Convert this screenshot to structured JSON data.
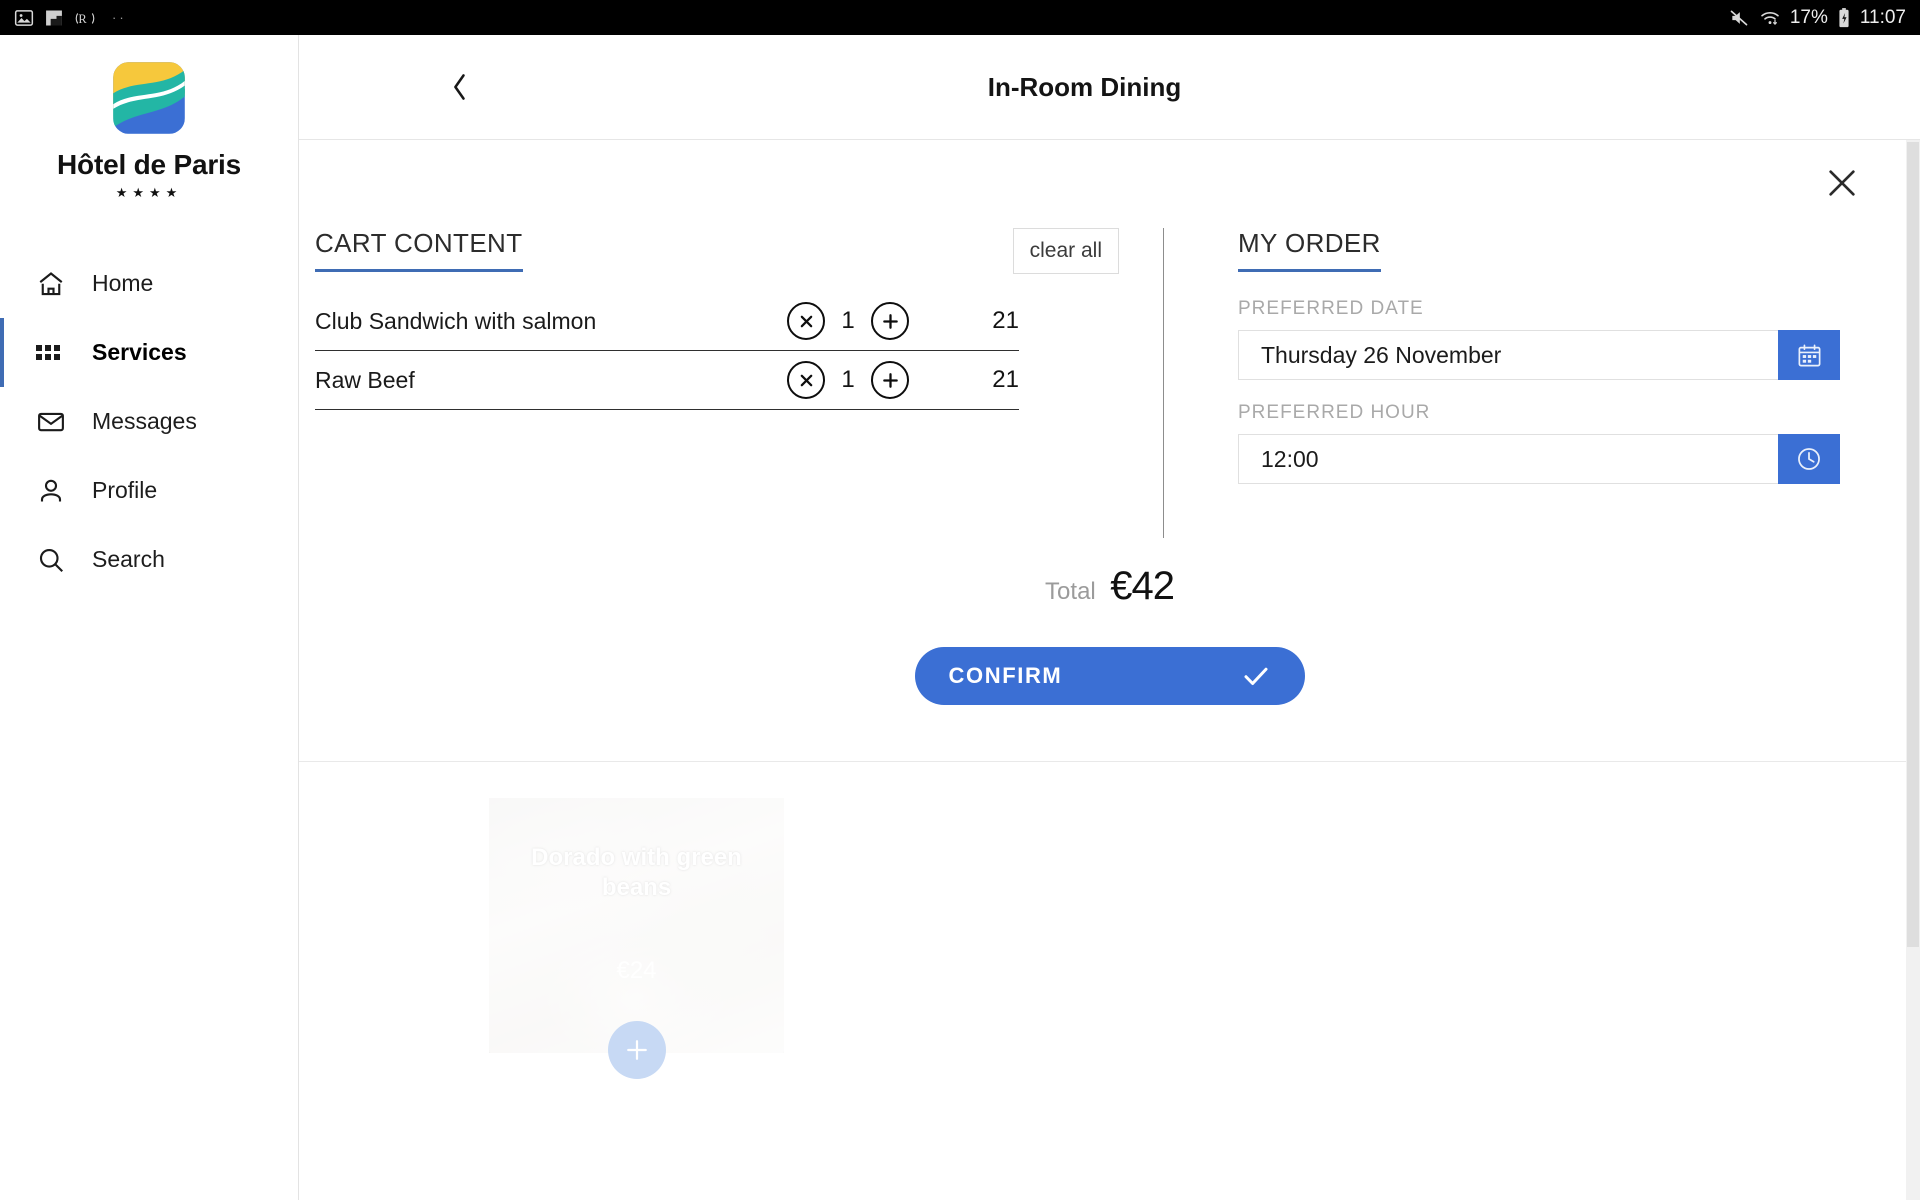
{
  "statusbar": {
    "left_icons": [
      "image-icon",
      "gallery-icon",
      "recorder-icon"
    ],
    "overflow_dots": "··",
    "mute_icon": "mute-icon",
    "wifi_icon": "wifi-icon",
    "battery_percent": "17%",
    "battery_icon": "battery-charging-icon",
    "time": "11:07"
  },
  "sidebar": {
    "logo": {
      "name": "Hôtel de Paris",
      "stars": "★★★★",
      "colors": {
        "top": "#f6c83c",
        "mid": "#23b6a5",
        "bottom": "#3b6fd4"
      }
    },
    "items": [
      {
        "label": "Home",
        "icon": "home-icon",
        "active": false
      },
      {
        "label": "Services",
        "icon": "grid-icon",
        "active": true
      },
      {
        "label": "Messages",
        "icon": "envelope-icon",
        "active": false
      },
      {
        "label": "Profile",
        "icon": "person-icon",
        "active": false
      },
      {
        "label": "Search",
        "icon": "search-icon",
        "active": false
      }
    ],
    "active_indicator_color": "#3f6cb4"
  },
  "topbar": {
    "back_icon": "chevron-left-icon",
    "title": "In-Room Dining"
  },
  "overlay": {
    "close_icon": "close-icon"
  },
  "cart": {
    "title": "CART CONTENT",
    "clear_all_label": "clear all",
    "remove_icon": "circle-x-icon",
    "add_icon": "circle-plus-icon",
    "items": [
      {
        "name": "Club Sandwich with salmon",
        "qty": "1",
        "price": "21"
      },
      {
        "name": "Raw Beef",
        "qty": "1",
        "price": "21"
      }
    ]
  },
  "order": {
    "title": "MY ORDER",
    "date_label": "PREFERRED DATE",
    "date_value": "Thursday 26 November",
    "date_icon": "calendar-icon",
    "hour_label": "PREFERRED HOUR",
    "hour_value": "12:00",
    "hour_icon": "clock-icon",
    "accent_color": "#3b6fd4"
  },
  "totals": {
    "label": "Total",
    "value": "€42"
  },
  "confirm": {
    "label": "CONFIRM",
    "icon": "check-icon",
    "color": "#3b6fd4"
  },
  "suggestion": {
    "title": "Dorado with green beans",
    "price": "€24",
    "add_icon": "plus-icon"
  }
}
